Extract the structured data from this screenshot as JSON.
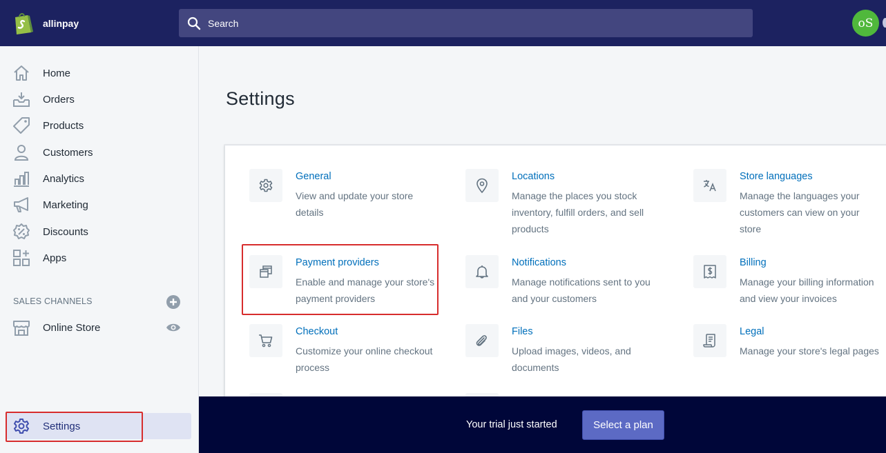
{
  "colors": {
    "topbar": "#1c2260",
    "search_bg": "#43467f",
    "accent_link": "#006fbb",
    "plan_button": "#5c6ac4",
    "trial_bar": "#000639",
    "avatar": "#50b83c",
    "highlight": "#d72c2c"
  },
  "header": {
    "store_name": "allinpay",
    "search_placeholder": "Search",
    "avatar_initials": "oS",
    "logo_icon": "shopify-bag-icon"
  },
  "sidebar": {
    "items": [
      {
        "label": "Home",
        "icon": "home-icon"
      },
      {
        "label": "Orders",
        "icon": "orders-icon"
      },
      {
        "label": "Products",
        "icon": "tag-icon"
      },
      {
        "label": "Customers",
        "icon": "person-icon"
      },
      {
        "label": "Analytics",
        "icon": "bar-chart-icon"
      },
      {
        "label": "Marketing",
        "icon": "megaphone-icon"
      },
      {
        "label": "Discounts",
        "icon": "discount-icon"
      },
      {
        "label": "Apps",
        "icon": "apps-icon"
      }
    ],
    "sales_channels_title": "SALES CHANNELS",
    "channels": [
      {
        "label": "Online Store",
        "icon": "store-icon"
      }
    ],
    "settings_label": "Settings"
  },
  "main": {
    "title": "Settings",
    "tiles": [
      {
        "title": "General",
        "desc": [
          "View and update your store",
          "details"
        ],
        "icon": "gear-icon"
      },
      {
        "title": "Locations",
        "desc": [
          "Manage the places you stock",
          "inventory, fulfill orders, and sell",
          "products"
        ],
        "icon": "location-pin-icon"
      },
      {
        "title": "Store languages",
        "desc": [
          "Manage the languages your",
          "customers can view on your",
          "store"
        ],
        "icon": "translate-icon"
      },
      {
        "title": "Payment providers",
        "desc": [
          "Enable and manage your store's",
          "payment providers"
        ],
        "icon": "payment-icon"
      },
      {
        "title": "Notifications",
        "desc": [
          "Manage notifications sent to you",
          "and your customers"
        ],
        "icon": "bell-icon"
      },
      {
        "title": "Billing",
        "desc": [
          "Manage your billing information",
          "and view your invoices"
        ],
        "icon": "billing-icon"
      },
      {
        "title": "Checkout",
        "desc": [
          "Customize your online checkout",
          "process"
        ],
        "icon": "cart-icon"
      },
      {
        "title": "Files",
        "desc": [
          "Upload images, videos, and",
          "documents"
        ],
        "icon": "paperclip-icon"
      },
      {
        "title": "Legal",
        "desc": [
          "Manage your store's legal pages"
        ],
        "icon": "legal-icon"
      }
    ]
  },
  "trial": {
    "message": "Your trial just started",
    "button_label": "Select a plan"
  }
}
